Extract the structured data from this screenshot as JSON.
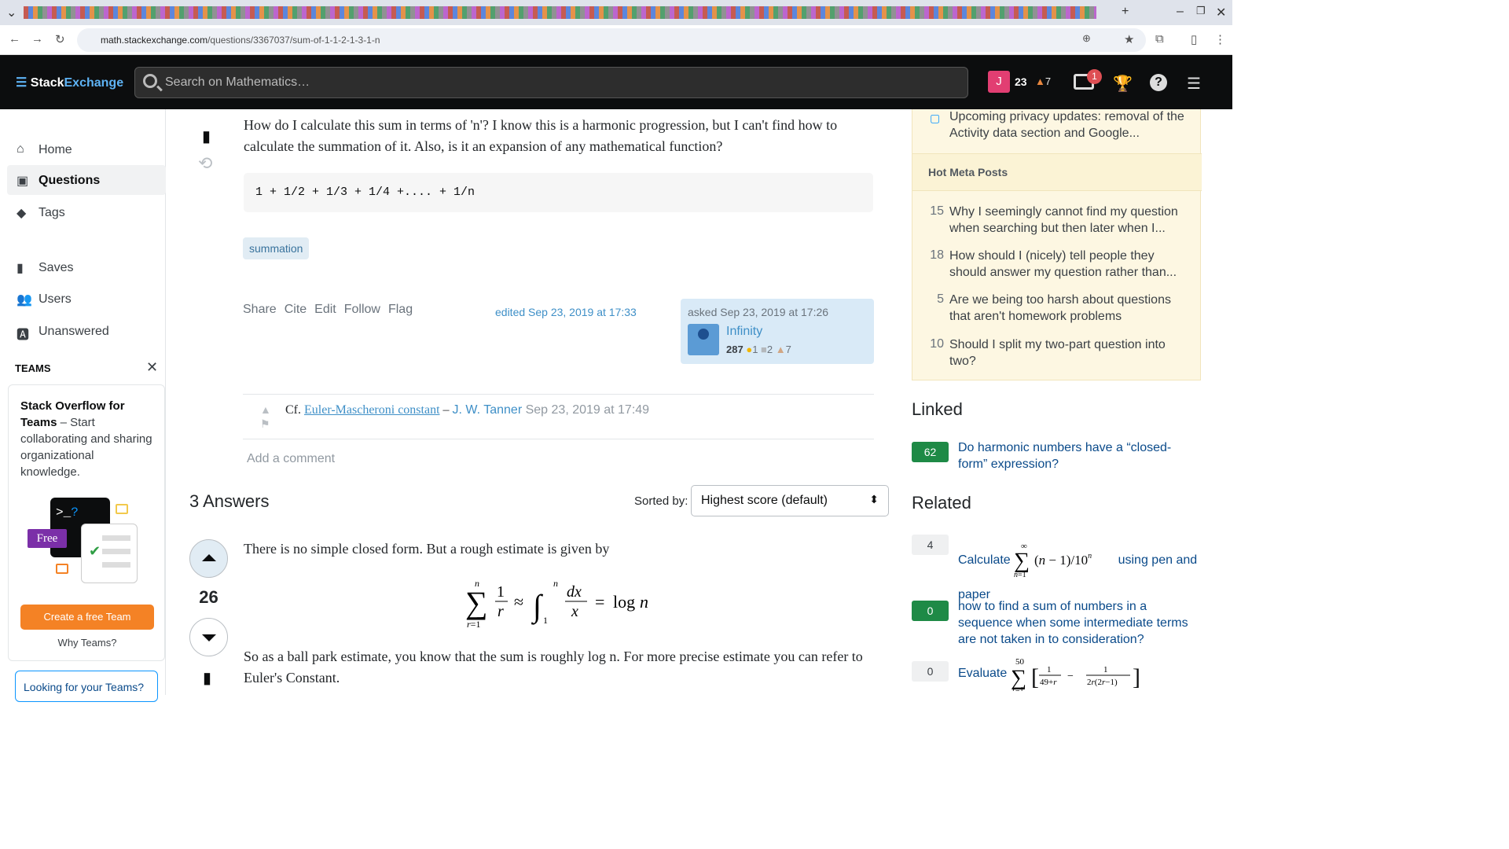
{
  "browser": {
    "url_domain": "math.stackexchange.com",
    "url_path": "/questions/3367037/sum-of-1-1-2-1-3-1-n"
  },
  "header": {
    "logo_stack": "Stack",
    "logo_exchange": "Exchange",
    "search_placeholder": "Search on Mathematics…",
    "avatar_letter": "J",
    "reputation": "23",
    "bronze_badges": "7",
    "inbox_count": "1"
  },
  "leftnav": {
    "items": [
      {
        "label": "Home",
        "icon": "home-icon"
      },
      {
        "label": "Questions",
        "icon": "questions-icon"
      },
      {
        "label": "Tags",
        "icon": "tag-icon"
      },
      {
        "label": "Saves",
        "icon": "bookmark-icon"
      },
      {
        "label": "Users",
        "icon": "users-icon"
      },
      {
        "label": "Unanswered",
        "icon": "unanswered-icon"
      }
    ],
    "teams_heading": "TEAMS",
    "teams_title": "Stack Overflow for Teams",
    "teams_desc": " – Start collaborating and sharing organizational knowledge.",
    "free_label": "Free",
    "create_team": "Create a free Team",
    "why_teams": "Why Teams?",
    "looking": "Looking for your Teams?"
  },
  "question": {
    "body": "How do I calculate this sum in terms of 'n'? I know this is a harmonic progression, but I can't find how to calculate the summation of it. Also, is it an expansion of any mathematical function?",
    "code": "1 + 1/2 + 1/3 + 1/4 +.... + 1/n",
    "tag": "summation",
    "actions": [
      "Share",
      "Cite",
      "Edit",
      "Follow",
      "Flag"
    ],
    "edited": "edited Sep 23, 2019 at 17:33",
    "asked": "asked Sep 23, 2019 at 17:26",
    "author": "Infinity",
    "author_rep": "287",
    "gold": "1",
    "silver": "2",
    "bronze": "7"
  },
  "comment": {
    "prefix": "Cf. ",
    "link": "Euler-Mascheroni constant",
    "dash": " – ",
    "user": "J. W. Tanner",
    "date": " Sep 23, 2019 at 17:49",
    "add": "Add a comment"
  },
  "answers": {
    "heading": "3 Answers",
    "sorted_by": "Sorted by:",
    "sort_value": "Highest score (default)",
    "top": {
      "score": "26",
      "line1": "There is no simple closed form. But a rough estimate is given by",
      "line2": "So as a ball park estimate, you know that the sum is roughly log n. For more precise estimate you can refer to Euler's Constant."
    }
  },
  "sidebar": {
    "blog_item": "Upcoming privacy updates: removal of the Activity data section and Google...",
    "hot_meta": "Hot Meta Posts",
    "meta_posts": [
      {
        "num": "15",
        "text": "Why I seemingly cannot find my question when searching but then later when I..."
      },
      {
        "num": "18",
        "text": "How should I (nicely) tell people they should answer my question rather than..."
      },
      {
        "num": "5",
        "text": "Are we being too harsh about questions that aren't homework problems"
      },
      {
        "num": "10",
        "text": "Should I split my two-part question into two?"
      }
    ],
    "linked_heading": "Linked",
    "linked": [
      {
        "score": "62",
        "text": "Do harmonic numbers have a “closed-form” expression?"
      }
    ],
    "related_heading": "Related",
    "related": [
      {
        "score": "4",
        "text_a": "Calculate ",
        "text_b": " using pen and paper"
      },
      {
        "score": "0",
        "text": "how to find a sum of numbers in a sequence when some intermediate terms are not taken in to consideration?"
      },
      {
        "score": "0",
        "text": "Evaluate "
      }
    ]
  }
}
